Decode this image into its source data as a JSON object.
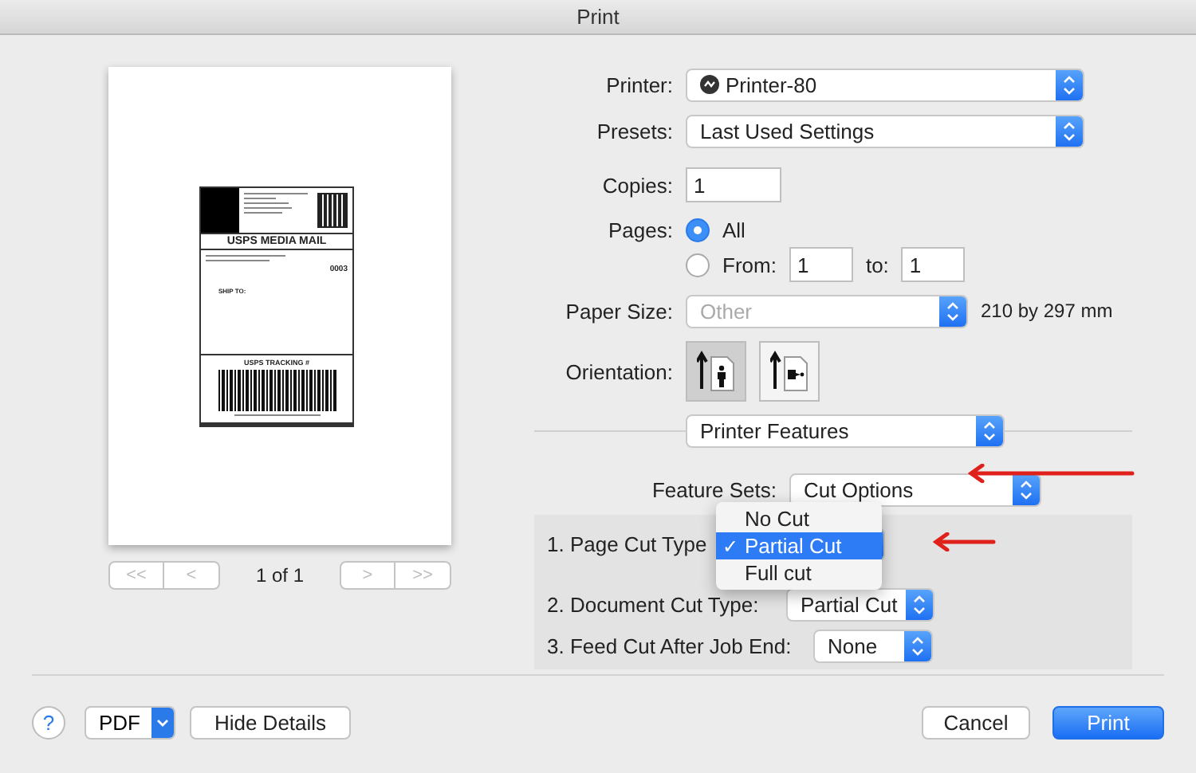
{
  "window": {
    "title": "Print"
  },
  "preview": {
    "label": {
      "service": "USPS MEDIA MAIL",
      "zone": "0003",
      "ship_to": "SHIP TO:",
      "tracking_title": "USPS TRACKING #"
    },
    "page_indicator": "1 of 1",
    "nav": [
      "<<",
      "<",
      ">",
      ">>"
    ]
  },
  "printer": {
    "label": "Printer:",
    "value": "Printer-80"
  },
  "presets": {
    "label": "Presets:",
    "value": "Last Used Settings"
  },
  "copies": {
    "label": "Copies:",
    "value": "1"
  },
  "pages": {
    "label": "Pages:",
    "options": [
      {
        "label": "All",
        "selected": true
      },
      {
        "label": "From:",
        "selected": false
      }
    ],
    "from": "1",
    "to_label": "to:",
    "to": "1"
  },
  "paper_size": {
    "label": "Paper Size:",
    "value": "Other",
    "size": "210 by 297 mm"
  },
  "orientation": {
    "label": "Orientation:",
    "options": [
      {
        "kind": "portrait",
        "selected": true
      },
      {
        "kind": "landscape",
        "selected": false
      }
    ]
  },
  "section": {
    "value": "Printer Features"
  },
  "feature_sets": {
    "label": "Feature Sets:",
    "value": "Cut Options"
  },
  "features": [
    {
      "label": "1. Page Cut Type"
    },
    {
      "label": "2. Document Cut Type:",
      "value": "Partial Cut"
    },
    {
      "label": "3. Feed Cut After Job End:",
      "value": "None"
    }
  ],
  "menu": {
    "items": [
      {
        "label": "No Cut",
        "selected": false
      },
      {
        "label": "Partial Cut",
        "selected": true
      },
      {
        "label": "Full cut",
        "selected": false
      }
    ],
    "check": "✓"
  },
  "buttons": {
    "help": "?",
    "pdf": "PDF",
    "hide_details": "Hide Details",
    "cancel": "Cancel",
    "print": "Print"
  }
}
